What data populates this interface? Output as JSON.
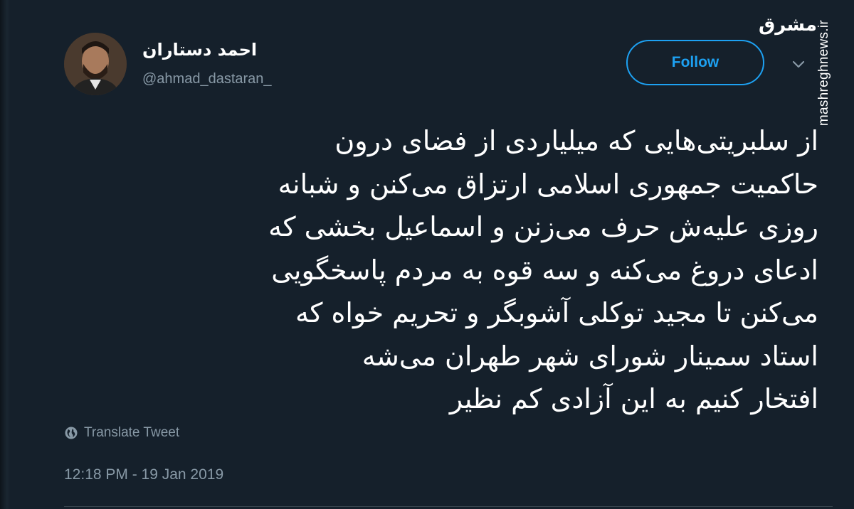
{
  "author": {
    "display_name": "احمد دستاران",
    "handle": "@ahmad_dastaran_"
  },
  "follow_label": "Follow",
  "tweet": {
    "lines": [
      "از سلبریتی‌هایی که میلیاردی از فضای درون",
      "حاکمیت جمهوری اسلامی ارتزاق می‌کنن و شبانه",
      "روزی علیه‌ش حرف می‌زنن و اسماعیل بخشی که",
      "ادعای دروغ می‌کنه و سه قوه به مردم پاسخگویی",
      "می‌کنن تا مجید توکلی آشوبگر و تحریم خواه که",
      "استاد سمینار شورای شهر طهران می‌شه",
      "افتخار کنیم به این آزادی کم نظیر"
    ]
  },
  "translate_label": "Translate Tweet",
  "timestamp": "12:18 PM - 19 Jan 2019",
  "watermark": {
    "logo_text": "مشرق",
    "site": "mashreghnews.ir"
  },
  "colors": {
    "background": "#15202b",
    "accent": "#1da1f2",
    "muted": "#8899a6",
    "text": "#ffffff"
  },
  "icons": {
    "globe": "globe-icon",
    "chevron": "chevron-down-icon"
  }
}
